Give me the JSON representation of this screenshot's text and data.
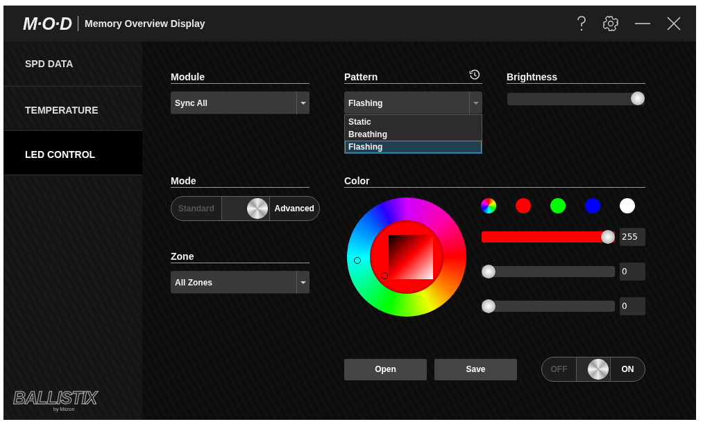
{
  "window": {
    "logo": "M·O·D",
    "title": "Memory Overview Display"
  },
  "sidebar": {
    "items": [
      {
        "label": "SPD DATA",
        "selected": false
      },
      {
        "label": "TEMPERATURE",
        "selected": false
      },
      {
        "label": "LED CONTROL",
        "selected": true
      }
    ],
    "brand": {
      "name": "BALLISTIX",
      "tagline": "by Micron"
    }
  },
  "module": {
    "label": "Module",
    "value": "Sync All"
  },
  "pattern": {
    "label": "Pattern",
    "value": "Flashing",
    "expanded": true,
    "options": [
      {
        "label": "Static",
        "selected": false
      },
      {
        "label": "Breathing",
        "selected": false
      },
      {
        "label": "Flashing",
        "selected": true
      }
    ]
  },
  "brightness": {
    "label": "Brightness",
    "level": 1
  },
  "mode": {
    "label": "Mode",
    "off_label": "Standard",
    "on_label": "Advanced",
    "on": true
  },
  "zone": {
    "label": "Zone",
    "value": "All Zones"
  },
  "color": {
    "label": "Color",
    "presets": [
      {
        "kind": "spectrum"
      },
      {
        "kind": "solid",
        "color": "#ff0000"
      },
      {
        "kind": "solid",
        "color": "#00ff00"
      },
      {
        "kind": "solid",
        "color": "#0000ff"
      },
      {
        "kind": "solid",
        "color": "#ffffff"
      }
    ],
    "channels": [
      {
        "level": 1,
        "reading": "255",
        "color": "#ff0000"
      },
      {
        "level": 0,
        "reading": "0"
      },
      {
        "level": 0,
        "reading": "0"
      }
    ]
  },
  "buttons": [
    "Open",
    "Save"
  ],
  "power": {
    "off_label": "OFF",
    "on_label": "ON",
    "on": true
  }
}
